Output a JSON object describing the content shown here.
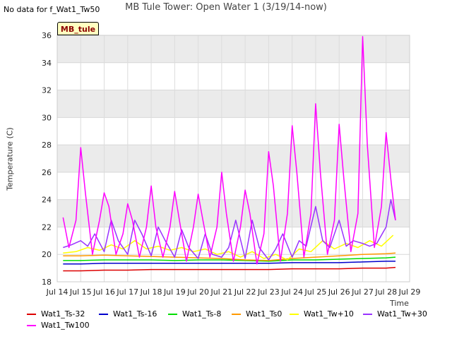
{
  "header": {
    "no_data_text": "No data for f_Wat1_Tw50",
    "title": "MB Tule Tower: Open Water 1 (3/19/14-now)",
    "badge": "MB_tule"
  },
  "chart_data": {
    "type": "line",
    "title": "MB Tule Tower: Open Water 1 (3/19/14-now)",
    "xlabel": "Time",
    "ylabel": "Temperature (C)",
    "xlim": [
      14,
      29
    ],
    "ylim": [
      18,
      36
    ],
    "x_ticks": [
      "Jul 14",
      "Jul 15",
      "Jul 16",
      "Jul 17",
      "Jul 18",
      "Jul 19",
      "Jul 20",
      "Jul 21",
      "Jul 22",
      "Jul 23",
      "Jul 24",
      "Jul 25",
      "Jul 26",
      "Jul 27",
      "Jul 28",
      "Jul 29"
    ],
    "y_ticks": [
      18,
      20,
      22,
      24,
      26,
      28,
      30,
      32,
      34,
      36
    ],
    "grid": true,
    "legend_position": "bottom",
    "series": [
      {
        "name": "Wat1_Ts-32",
        "color": "#dd0000",
        "x": [
          14.25,
          15,
          16,
          17,
          18,
          19,
          20,
          21,
          22,
          23,
          24,
          25,
          26,
          27,
          28,
          28.4
        ],
        "y": [
          18.8,
          18.8,
          18.85,
          18.85,
          18.9,
          18.9,
          18.9,
          18.9,
          18.9,
          18.9,
          18.95,
          18.95,
          18.95,
          19.0,
          19.0,
          19.05
        ]
      },
      {
        "name": "Wat1_Ts-16",
        "color": "#0000cc",
        "x": [
          14.25,
          15,
          16,
          17,
          18,
          19,
          20,
          21,
          22,
          23,
          24,
          25,
          26,
          27,
          28,
          28.4
        ],
        "y": [
          19.3,
          19.3,
          19.35,
          19.35,
          19.35,
          19.35,
          19.35,
          19.35,
          19.35,
          19.35,
          19.4,
          19.4,
          19.4,
          19.45,
          19.5,
          19.5
        ]
      },
      {
        "name": "Wat1_Ts-8",
        "color": "#00dd00",
        "x": [
          14.25,
          15,
          16,
          17,
          18,
          19,
          20,
          21,
          22,
          23,
          24,
          25,
          26,
          27,
          28,
          28.4
        ],
        "y": [
          19.55,
          19.55,
          19.6,
          19.6,
          19.6,
          19.55,
          19.6,
          19.6,
          19.55,
          19.5,
          19.6,
          19.6,
          19.65,
          19.7,
          19.75,
          19.8
        ]
      },
      {
        "name": "Wat1_Ts0",
        "color": "#ff9900",
        "x": [
          14.25,
          15,
          16,
          17,
          18,
          19,
          20,
          21,
          22,
          23,
          24,
          25,
          26,
          27,
          28,
          28.4
        ],
        "y": [
          19.9,
          19.9,
          19.95,
          19.9,
          19.85,
          19.8,
          19.75,
          19.7,
          19.6,
          19.55,
          19.7,
          19.8,
          19.9,
          20.0,
          20.05,
          20.1
        ]
      },
      {
        "name": "Wat1_Tw+10",
        "color": "#ffff00",
        "x": [
          14.25,
          14.8,
          15.3,
          15.8,
          16.3,
          16.8,
          17.3,
          17.8,
          18.3,
          18.8,
          19.3,
          19.8,
          20.3,
          20.8,
          21.3,
          21.8,
          22.3,
          22.8,
          23.3,
          23.8,
          24.3,
          24.8,
          25.3,
          25.8,
          26.3,
          26.8,
          27.3,
          27.8,
          28.3
        ],
        "y": [
          20.1,
          20.2,
          20.5,
          20.3,
          20.7,
          20.4,
          21.0,
          20.4,
          20.6,
          20.3,
          20.5,
          20.2,
          20.4,
          20.0,
          20.2,
          19.8,
          20.2,
          19.7,
          20.0,
          19.6,
          20.4,
          20.2,
          21.0,
          20.4,
          20.8,
          20.5,
          21.0,
          20.6,
          21.4
        ]
      },
      {
        "name": "Wat1_Tw+30",
        "color": "#9933ff",
        "x": [
          14.25,
          14.6,
          15.0,
          15.3,
          15.6,
          16.0,
          16.3,
          16.6,
          17.0,
          17.3,
          17.6,
          18.0,
          18.3,
          18.6,
          19.0,
          19.3,
          19.6,
          20.0,
          20.3,
          20.6,
          21.0,
          21.3,
          21.6,
          22.0,
          22.3,
          22.6,
          23.0,
          23.3,
          23.6,
          24.0,
          24.3,
          24.6,
          25.0,
          25.3,
          25.6,
          26.0,
          26.3,
          26.6,
          27.0,
          27.3,
          27.6,
          28.0,
          28.2,
          28.4
        ],
        "y": [
          20.5,
          20.7,
          21.0,
          20.6,
          21.5,
          20.2,
          22.5,
          21.0,
          20.0,
          22.5,
          21.5,
          19.9,
          22.0,
          21.0,
          19.8,
          21.8,
          20.5,
          19.7,
          21.5,
          20.0,
          19.8,
          20.5,
          22.5,
          19.7,
          22.5,
          20.5,
          19.6,
          20.4,
          21.5,
          19.8,
          21.0,
          20.6,
          23.5,
          21.0,
          20.5,
          22.5,
          20.6,
          21.0,
          20.8,
          20.6,
          20.8,
          22.0,
          24.0,
          22.5
        ]
      },
      {
        "name": "Wat1_Tw100",
        "color": "#ff00ff",
        "x": [
          14.25,
          14.5,
          14.8,
          15.0,
          15.2,
          15.5,
          15.8,
          16.0,
          16.2,
          16.5,
          16.8,
          17.0,
          17.2,
          17.5,
          17.8,
          18.0,
          18.2,
          18.5,
          18.8,
          19.0,
          19.2,
          19.5,
          19.8,
          20.0,
          20.2,
          20.5,
          20.8,
          21.0,
          21.2,
          21.5,
          21.8,
          22.0,
          22.2,
          22.5,
          22.8,
          23.0,
          23.2,
          23.5,
          23.8,
          24.0,
          24.2,
          24.5,
          24.8,
          25.0,
          25.2,
          25.5,
          25.8,
          26.0,
          26.2,
          26.5,
          26.8,
          27.0,
          27.2,
          27.5,
          27.8,
          28.0,
          28.2,
          28.4
        ],
        "y": [
          22.7,
          20.5,
          22.5,
          27.8,
          24.5,
          20.0,
          22.5,
          24.5,
          23.5,
          20.0,
          21.5,
          23.7,
          22.5,
          19.8,
          22.0,
          25.0,
          22.0,
          19.8,
          22.0,
          24.6,
          22.5,
          19.5,
          22.0,
          24.4,
          22.5,
          19.8,
          22.0,
          26.0,
          23.0,
          19.5,
          22.0,
          24.7,
          23.0,
          19.3,
          21.5,
          27.5,
          25.0,
          19.5,
          23.0,
          29.4,
          26.0,
          19.8,
          23.0,
          31.0,
          26.0,
          20.0,
          22.5,
          29.5,
          25.5,
          20.2,
          23.0,
          35.9,
          28.0,
          20.5,
          23.5,
          28.9,
          25.5,
          22.5
        ]
      }
    ]
  }
}
